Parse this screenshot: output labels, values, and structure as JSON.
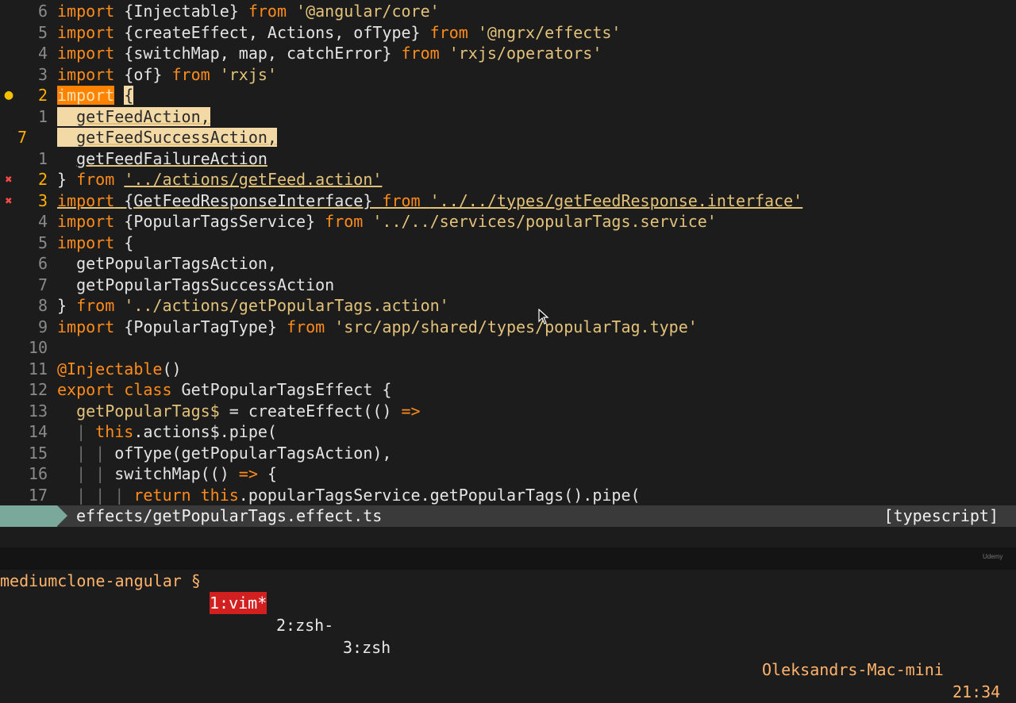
{
  "editor": {
    "lines": [
      {
        "num": "6",
        "sign": "",
        "code": [
          {
            "t": "import",
            "c": "k"
          },
          {
            "t": " {Injectable} ",
            "c": "fn"
          },
          {
            "t": "from",
            "c": "k"
          },
          {
            "t": " ",
            "c": "fn"
          },
          {
            "t": "'@angular/core'",
            "c": "s"
          }
        ]
      },
      {
        "num": "5",
        "sign": "",
        "code": [
          {
            "t": "import",
            "c": "k"
          },
          {
            "t": " {createEffect, Actions, ofType} ",
            "c": "fn"
          },
          {
            "t": "from",
            "c": "k"
          },
          {
            "t": " ",
            "c": "fn"
          },
          {
            "t": "'@ngrx/effects'",
            "c": "s"
          }
        ]
      },
      {
        "num": "4",
        "sign": "",
        "code": [
          {
            "t": "import",
            "c": "k"
          },
          {
            "t": " {switchMap, map, catchError} ",
            "c": "fn"
          },
          {
            "t": "from",
            "c": "k"
          },
          {
            "t": " ",
            "c": "fn"
          },
          {
            "t": "'rxjs/operators'",
            "c": "s"
          }
        ]
      },
      {
        "num": "3",
        "sign": "",
        "code": [
          {
            "t": "import",
            "c": "k"
          },
          {
            "t": " {of} ",
            "c": "fn"
          },
          {
            "t": "from",
            "c": "k"
          },
          {
            "t": " ",
            "c": "fn"
          },
          {
            "t": "'rxjs'",
            "c": "s"
          }
        ]
      },
      {
        "num": "2",
        "sign": "warn",
        "numClass": "curr",
        "code": [
          {
            "t": "import",
            "c": "k hlinc"
          },
          {
            "t": " ",
            "c": "fn"
          },
          {
            "t": "{",
            "c": "hlsel"
          }
        ]
      },
      {
        "num": "1",
        "sign": "",
        "code": [
          {
            "t": "  ",
            "c": "hlsel"
          },
          {
            "t": "getFeedAction,",
            "c": "hlsel ul"
          }
        ]
      },
      {
        "num": "7",
        "sign": "",
        "numClass": "mark",
        "code": [
          {
            "t": "  ",
            "c": "hlsel"
          },
          {
            "t": "getFeedSuccessAction,",
            "c": "hlsel ul"
          }
        ]
      },
      {
        "num": "1",
        "sign": "",
        "code": [
          {
            "t": "  ",
            "c": "fn"
          },
          {
            "t": "getFeedFailureAction",
            "c": "fn ul"
          }
        ]
      },
      {
        "num": "2",
        "sign": "err",
        "numClass": "curr",
        "code": [
          {
            "t": "} ",
            "c": "fn"
          },
          {
            "t": "from",
            "c": "k"
          },
          {
            "t": " ",
            "c": "fn"
          },
          {
            "t": "'../actions/getFeed.action'",
            "c": "s ul"
          }
        ]
      },
      {
        "num": "3",
        "sign": "err",
        "numClass": "curr",
        "code": [
          {
            "t": "import",
            "c": "k ul"
          },
          {
            "t": " {GetFeedResponseInterface} ",
            "c": "fn ul"
          },
          {
            "t": "from",
            "c": "k ul"
          },
          {
            "t": " ",
            "c": "fn ul"
          },
          {
            "t": "'../../types/getFeedResponse.interface'",
            "c": "s ul"
          }
        ]
      },
      {
        "num": "4",
        "sign": "",
        "code": [
          {
            "t": "import",
            "c": "k"
          },
          {
            "t": " {PopularTagsService} ",
            "c": "fn"
          },
          {
            "t": "from",
            "c": "k"
          },
          {
            "t": " ",
            "c": "fn"
          },
          {
            "t": "'../../services/popularTags.service'",
            "c": "s"
          }
        ]
      },
      {
        "num": "5",
        "sign": "",
        "code": [
          {
            "t": "import",
            "c": "k"
          },
          {
            "t": " {",
            "c": "fn"
          }
        ]
      },
      {
        "num": "6",
        "sign": "",
        "code": [
          {
            "t": "  getPopularTagsAction,",
            "c": "fn"
          }
        ]
      },
      {
        "num": "7",
        "sign": "",
        "code": [
          {
            "t": "  getPopularTagsSuccessAction",
            "c": "fn"
          }
        ]
      },
      {
        "num": "8",
        "sign": "",
        "code": [
          {
            "t": "} ",
            "c": "fn"
          },
          {
            "t": "from",
            "c": "k"
          },
          {
            "t": " ",
            "c": "fn"
          },
          {
            "t": "'../actions/getPopularTags.action'",
            "c": "s"
          }
        ]
      },
      {
        "num": "9",
        "sign": "",
        "code": [
          {
            "t": "import",
            "c": "k"
          },
          {
            "t": " {PopularTagType} ",
            "c": "fn"
          },
          {
            "t": "from",
            "c": "k"
          },
          {
            "t": " ",
            "c": "fn"
          },
          {
            "t": "'src/app/shared/types/popularTag.type'",
            "c": "s"
          }
        ]
      },
      {
        "num": "10",
        "sign": "",
        "code": []
      },
      {
        "num": "11",
        "sign": "",
        "code": [
          {
            "t": "@Injectable",
            "c": "k"
          },
          {
            "t": "()",
            "c": "fn"
          }
        ]
      },
      {
        "num": "12",
        "sign": "",
        "code": [
          {
            "t": "export",
            "c": "k"
          },
          {
            "t": " ",
            "c": "fn"
          },
          {
            "t": "class",
            "c": "k"
          },
          {
            "t": " GetPopularTagsEffect {",
            "c": "fn"
          }
        ]
      },
      {
        "num": "13",
        "sign": "",
        "code": [
          {
            "t": "  ",
            "c": "fn"
          },
          {
            "t": "getPopularTags$",
            "c": "s"
          },
          {
            "t": " = createEffect(() ",
            "c": "fn"
          },
          {
            "t": "=>",
            "c": "k"
          }
        ]
      },
      {
        "num": "14",
        "sign": "",
        "code": [
          {
            "t": "  | ",
            "c": "g"
          },
          {
            "t": "this",
            "c": "k"
          },
          {
            "t": ".actions$.pipe(",
            "c": "fn"
          }
        ]
      },
      {
        "num": "15",
        "sign": "",
        "code": [
          {
            "t": "  | | ",
            "c": "g"
          },
          {
            "t": "ofType(getPopularTagsAction),",
            "c": "fn"
          }
        ]
      },
      {
        "num": "16",
        "sign": "",
        "code": [
          {
            "t": "  | | ",
            "c": "g"
          },
          {
            "t": "switchMap(() ",
            "c": "fn"
          },
          {
            "t": "=>",
            "c": "k"
          },
          {
            "t": " {",
            "c": "fn"
          }
        ]
      },
      {
        "num": "17",
        "sign": "",
        "code": [
          {
            "t": "  | | | ",
            "c": "g"
          },
          {
            "t": "return",
            "c": "k"
          },
          {
            "t": " ",
            "c": "fn"
          },
          {
            "t": "this",
            "c": "k"
          },
          {
            "t": ".popularTagsService.getPopularTags().pipe(",
            "c": "fn"
          }
        ]
      }
    ]
  },
  "statusline": {
    "filename": "effects/getPopularTags.effect.ts",
    "filetype": "[typescript]"
  },
  "tmux": {
    "session": "mediumclone-angular §",
    "window1": "1:vim*",
    "window2": "2:zsh-",
    "window3": "3:zsh",
    "host": "Oleksandrs-Mac-mini",
    "time": "21:34"
  },
  "signs": {
    "warn": "●",
    "err": "✖"
  },
  "colors": {
    "keyword": "#ff8c1a",
    "string": "#e3c27a",
    "selection": "#f2d9a5",
    "tmux_active": "#d21f1f",
    "statusline_mode": "#7aa89a"
  },
  "watermark": "Udemy"
}
